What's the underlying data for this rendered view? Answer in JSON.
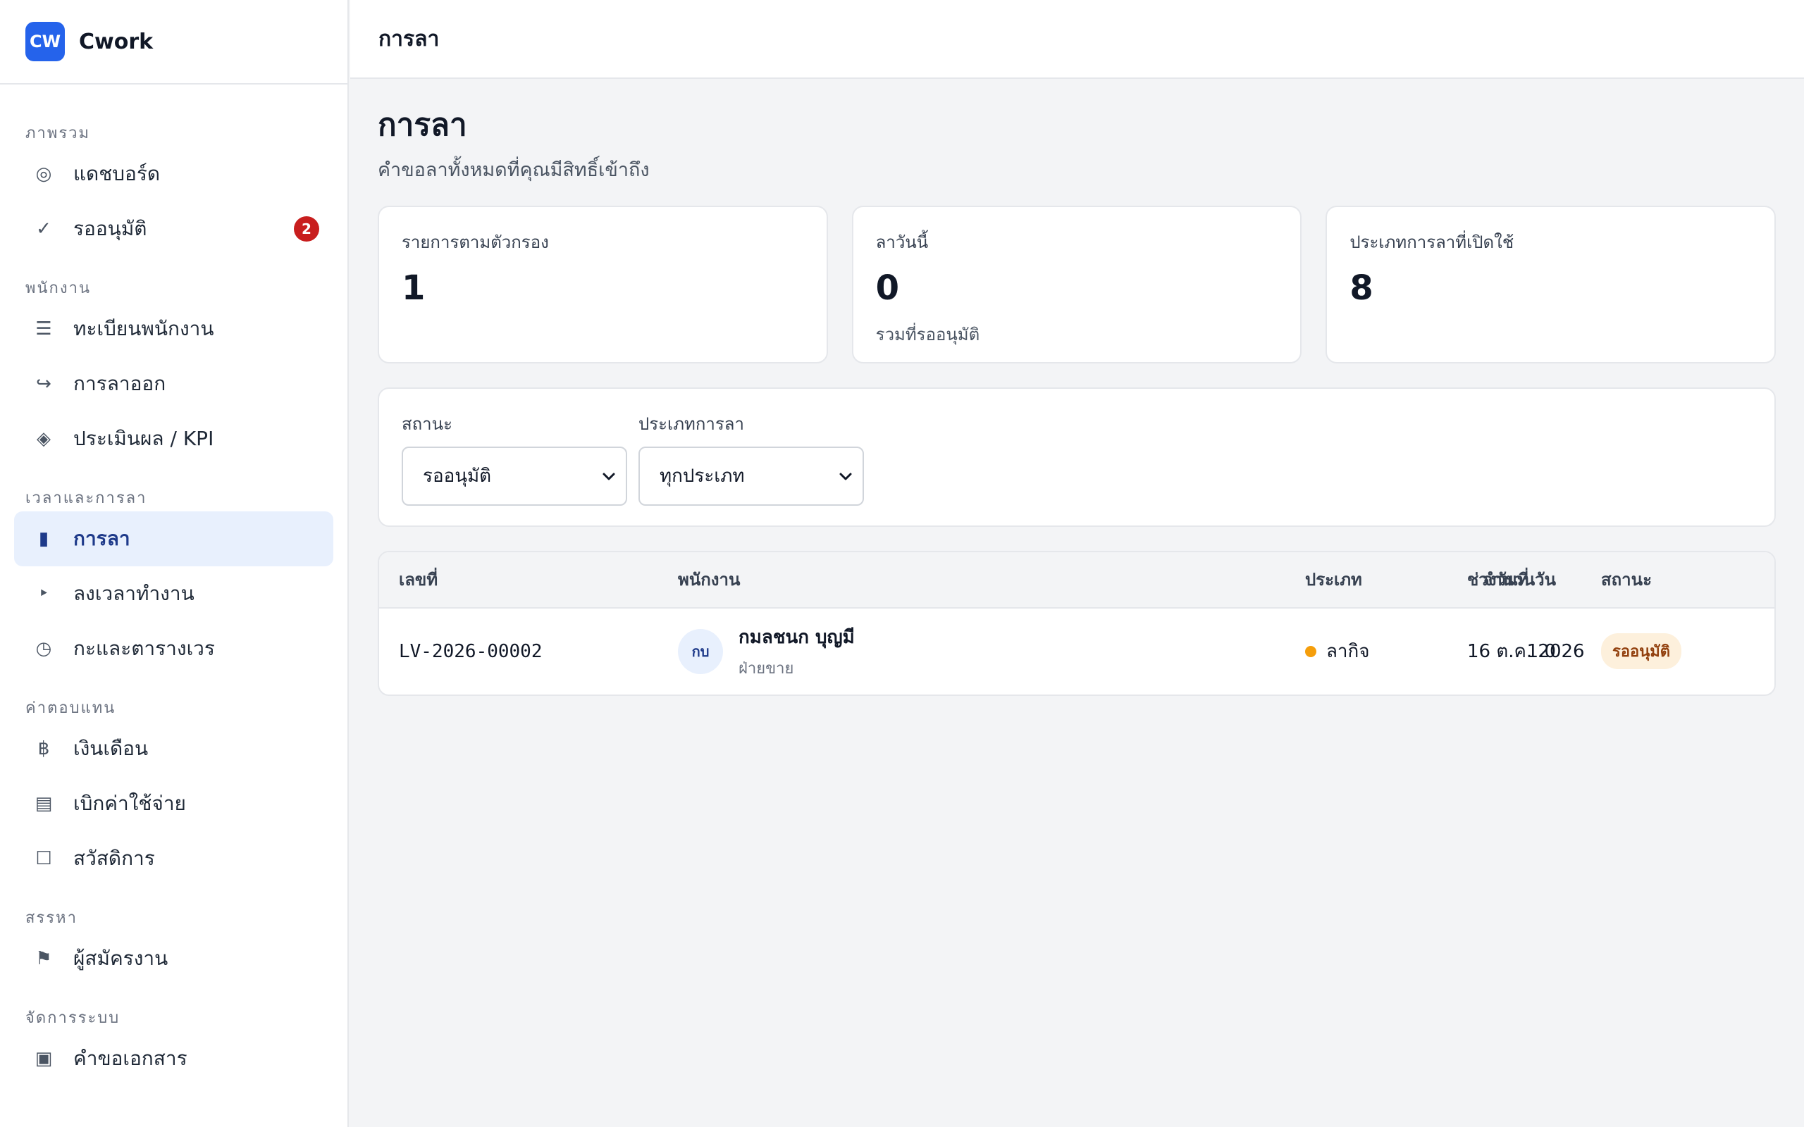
{
  "app": {
    "logo": "CW",
    "name": "Cwork"
  },
  "sidebar": {
    "sections": [
      {
        "title": "ภาพรวม",
        "items": [
          {
            "label": "แดชบอร์ด",
            "icon": "dashboard-icon"
          },
          {
            "label": "รออนุมัติ",
            "icon": "check-icon",
            "badge": "2"
          }
        ]
      },
      {
        "title": "พนักงาน",
        "items": [
          {
            "label": "ทะเบียนพนักงาน",
            "icon": "list-icon"
          },
          {
            "label": "การลาออก",
            "icon": "exit-arrow-icon"
          },
          {
            "label": "ประเมินผล / KPI",
            "icon": "diamond-icon"
          }
        ]
      },
      {
        "title": "เวลาและการลา",
        "items": [
          {
            "label": "การลา",
            "icon": "leave-icon",
            "active": true
          },
          {
            "label": "ลงเวลาทำงาน",
            "icon": "timeclock-icon"
          },
          {
            "label": "กะและตารางเวร",
            "icon": "clock-icon"
          }
        ]
      },
      {
        "title": "ค่าตอบแทน",
        "items": [
          {
            "label": "เงินเดือน",
            "icon": "baht-icon"
          },
          {
            "label": "เบิกค่าใช้จ่าย",
            "icon": "receipt-icon"
          },
          {
            "label": "สวัสดิการ",
            "icon": "box-icon"
          }
        ]
      },
      {
        "title": "สรรหา",
        "items": [
          {
            "label": "ผู้สมัครงาน",
            "icon": "flag-icon"
          }
        ]
      },
      {
        "title": "จัดการระบบ",
        "items": [
          {
            "label": "คำขอเอกสาร",
            "icon": "document-icon"
          }
        ]
      }
    ]
  },
  "topbar": {
    "title": "การลา"
  },
  "page": {
    "title": "การลา",
    "subtitle": "คำขอลาทั้งหมดที่คุณมีสิทธิ์เข้าถึง"
  },
  "stats": [
    {
      "label": "รายการตามตัวกรอง",
      "value": "1",
      "note": ""
    },
    {
      "label": "ลาวันนี้",
      "value": "0",
      "note": "รวมที่รออนุมัติ"
    },
    {
      "label": "ประเภทการลาที่เปิดใช้",
      "value": "8",
      "note": ""
    }
  ],
  "filters": {
    "status": {
      "label": "สถานะ",
      "value": "รออนุมัติ"
    },
    "leave_type": {
      "label": "ประเภทการลา",
      "value": "ทุกประเภท"
    }
  },
  "table": {
    "columns": {
      "id": "เลขที่",
      "employee": "พนักงาน",
      "type": "ประเภท",
      "range": "ช่วงวันที่",
      "days": "จำนวนวัน",
      "status": "สถานะ"
    },
    "rows": [
      {
        "id": "LV-2026-00002",
        "avatar": "กบ",
        "name": "กมลชนก บุญมี",
        "department": "ฝ่ายขาย",
        "type": "ลากิจ",
        "type_color": "#f59e0b",
        "range": "16 ต.ค. 2026",
        "days": "1.0",
        "status": "รออนุมัติ"
      }
    ]
  },
  "colors": {
    "accent": "#2563eb",
    "active_bg": "#e8f0fd",
    "badge": "#c81e1e",
    "pending_bg": "#fdf0dc",
    "pending_text": "#92400e"
  }
}
